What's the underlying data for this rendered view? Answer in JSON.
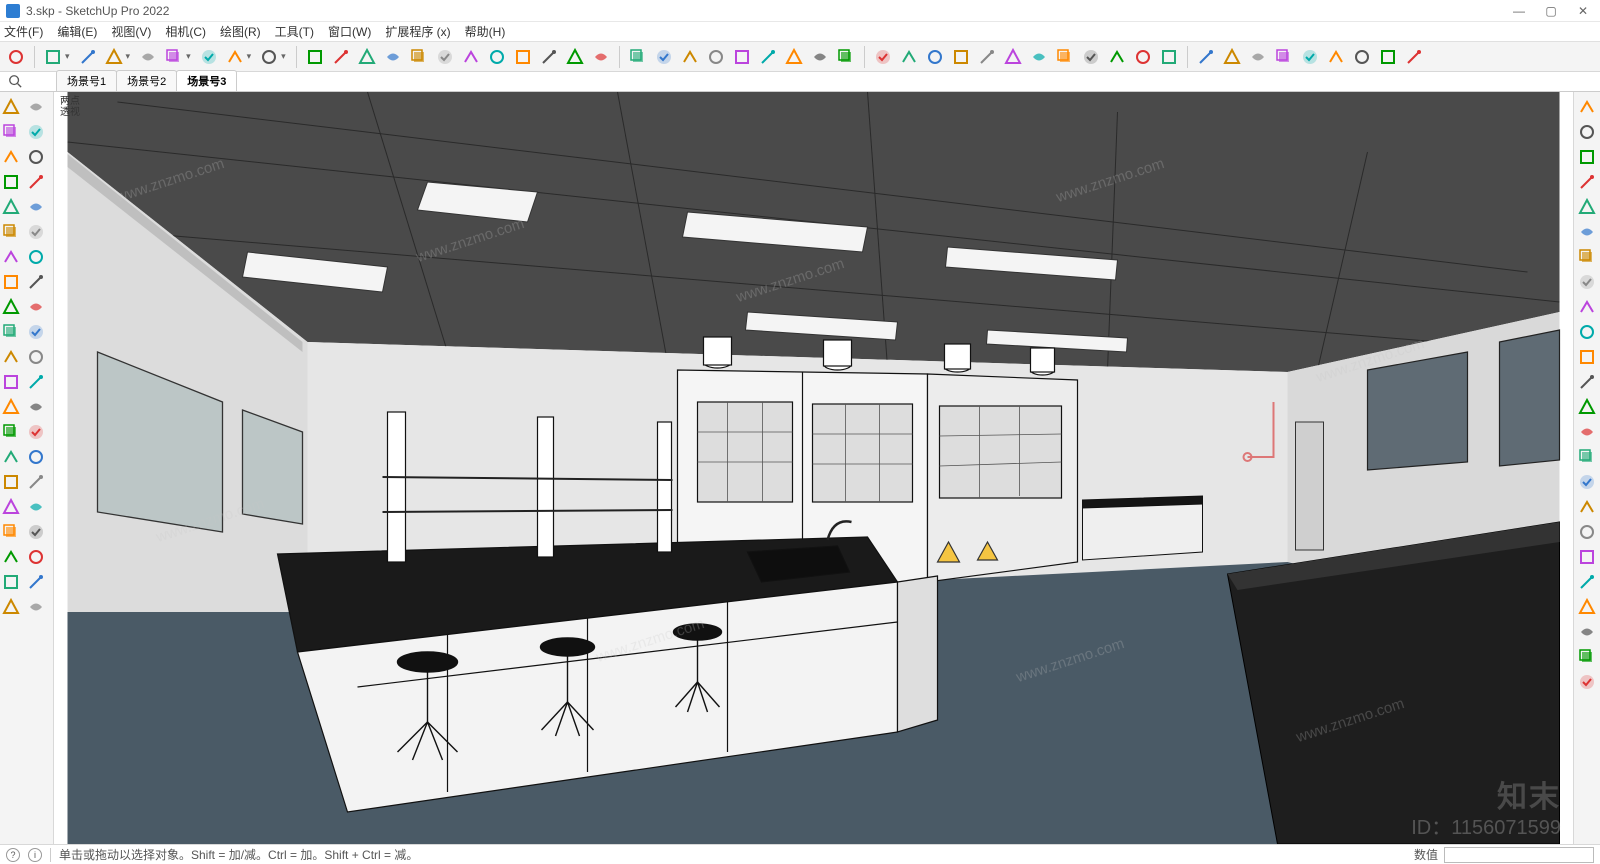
{
  "title": "3.skp - SketchUp Pro 2022",
  "menus": [
    "文件(F)",
    "编辑(E)",
    "视图(V)",
    "相机(C)",
    "绘图(R)",
    "工具(T)",
    "窗口(W)",
    "扩展程序 (x)",
    "帮助(H)"
  ],
  "scene_tabs": [
    "场景号1",
    "场景号2",
    "场景号3"
  ],
  "active_scene": 2,
  "top_toolbar_icons": [
    "search-icon",
    "select-arrow-icon",
    "eraser-icon",
    "pencil-icon",
    "freehand-icon",
    "rectangle-icon",
    "arc-icon",
    "circle-icon",
    "polygon-icon",
    "push-pull-icon",
    "offset-icon",
    "move-icon",
    "rotate-icon",
    "scale-icon",
    "tape-icon",
    "protractor-icon",
    "text-icon",
    "axes-icon",
    "dimension-icon",
    "paint-icon",
    "section-icon",
    "orbit-icon",
    "pan-icon",
    "zoom-icon",
    "zoom-extents-icon",
    "orbit-cam-icon",
    "walk-icon",
    "look-icon",
    "position-cam-icon",
    "user-icon",
    "extension-warehouse-icon",
    "extension-manager-icon",
    "vray-icon",
    "layers-icon",
    "add-icon",
    "tree-icon",
    "palette-icon",
    "checker-icon",
    "cloud-icon",
    "settings-icon",
    "mail-icon",
    "info-icon",
    "box-icon",
    "cylinder-icon",
    "sphere-icon",
    "house-icon",
    "cube-icon",
    "roof-icon",
    "home-icon",
    "window-icon",
    "panel-icon"
  ],
  "left_toolbar_icons": [
    "select-icon",
    "lasso-icon",
    "eraser2-icon",
    "component-icon",
    "material-icon",
    "line-icon",
    "freehand2-icon",
    "rect2-icon",
    "rotrect-icon",
    "circle2-icon",
    "pie-icon",
    "arc2-icon",
    "arc3-icon",
    "bezier-icon",
    "pushpull2-icon",
    "offset2-icon",
    "follow-icon",
    "move2-icon",
    "rotate2-icon",
    "scale2-icon",
    "tape2-icon",
    "text2-icon",
    "axes2-icon",
    "dim2-icon",
    "protractor2-icon",
    "paint2-icon",
    "3dtext-icon",
    "orbit2-icon",
    "pan2-icon",
    "zoom2-icon",
    "zoomwin-icon",
    "zoomext2-icon",
    "prev-icon",
    "next-icon",
    "position2-icon",
    "walk2-icon",
    "look2-icon",
    "section2-icon",
    "outliner-icon",
    "layers2-icon",
    "sun-icon",
    "settings2-icon"
  ],
  "right_toolbar_icons": [
    "undo-icon",
    "redo-icon",
    "align-top-icon",
    "align-mid-icon",
    "align-bot-icon",
    "flip-h-icon",
    "flip-v-icon",
    "column-icon",
    "grid-icon",
    "grid2-icon",
    "grid3-icon",
    "red-box-icon",
    "red-frame-icon",
    "move-r-icon",
    "rotate-r-icon",
    "scale-r-icon",
    "mirror-icon",
    "array-icon",
    "kg-icon",
    "measure-icon",
    "layer-r-icon",
    "paint-r-icon",
    "chart-icon",
    "gear-r-icon"
  ],
  "viewport_label_top": "两点\n透视",
  "watermark_url": "www.znzmo.com",
  "watermark_brand": "知末",
  "watermark_id": "ID：1156071599",
  "status_hint": "单击或拖动以选择对象。Shift = 加/减。Ctrl = 加。Shift + Ctrl = 减。",
  "status_value_label": "数值"
}
